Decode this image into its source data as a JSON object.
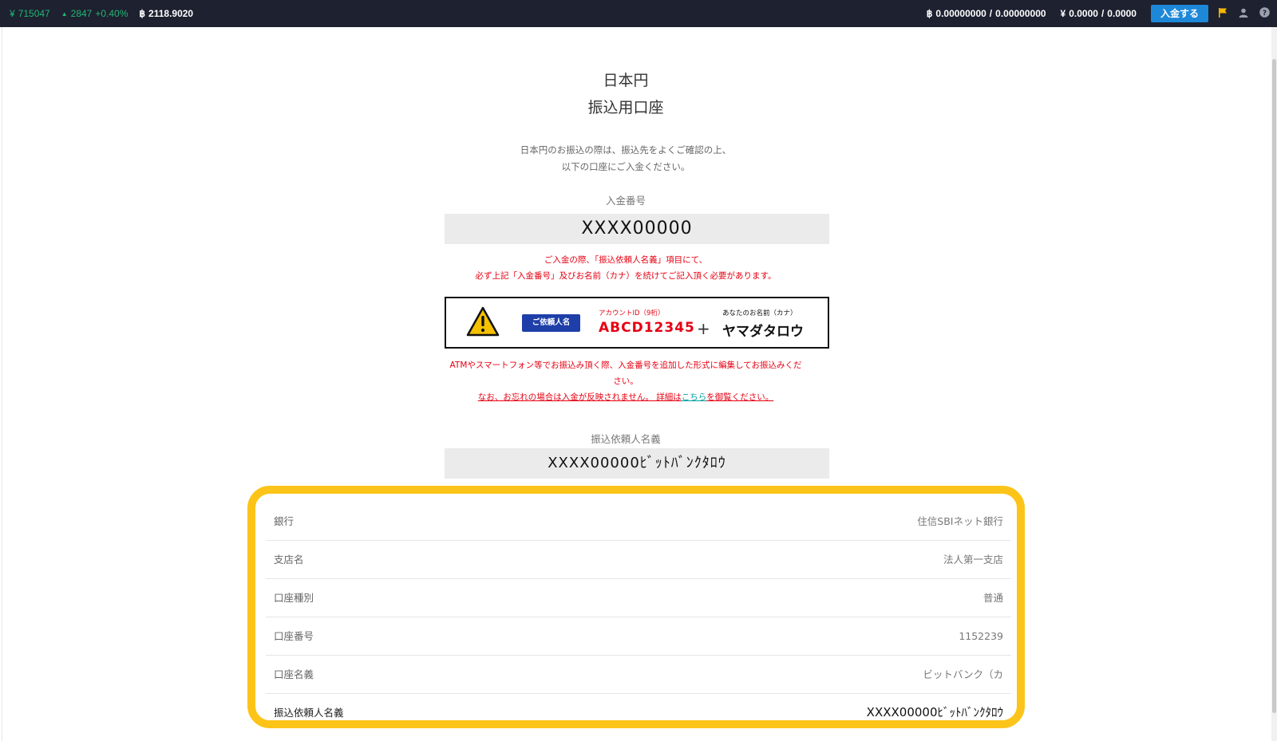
{
  "topbar": {
    "jpy_price": "715047",
    "change_amount": "2847",
    "change_pct": "+0.40%",
    "btc_amount": "2118.9020",
    "btc_balance": "0.00000000",
    "btc_available": "0.00000000",
    "jpy_balance": "0.0000",
    "jpy_available": "0.0000",
    "separator": "/",
    "deposit_button": "入金する",
    "yen_symbol": "¥",
    "btc_symbol": "฿",
    "up_arrow": "▲"
  },
  "header": {
    "title_line1": "日本円",
    "title_line2": "振込用口座"
  },
  "intro": {
    "line1": "日本円のお振込の際は、振込先をよくご確認の上、",
    "line2": "以下の口座にご入金ください。"
  },
  "deposit_number": {
    "label": "入金番号",
    "value": "XXXX00000"
  },
  "red_notice": {
    "line1": "ご入金の際、「振込依頼人名義」項目にて、",
    "line2": "必ず上記「入金番号」及びお名前（カナ）を続けてご記入頂く必要があります。"
  },
  "example_box": {
    "badge": "ご依頼人名",
    "account_label": "アカウントID（9桁）",
    "account_value": "ABCD12345",
    "plus": "+",
    "name_label": "あなたのお名前（カナ）",
    "name_value": "ヤマダタロウ"
  },
  "atm_notice": {
    "line1": "ATMやスマートフォン等でお振込み頂く際、入金番号を追加した形式に編集してお振込みくだ",
    "line2": "さい。",
    "line3_pre": "なお、お忘れの場合は入金が反映されません。 詳細は",
    "line3_link": "こちら",
    "line3_post": "を御覧ください。"
  },
  "requester": {
    "label": "振込依頼人名義",
    "value": "XXXX00000ﾋﾞｯﾄﾊﾞﾝｸﾀﾛｳ"
  },
  "bank_info": [
    {
      "key": "銀行",
      "value": "住信SBIネット銀行"
    },
    {
      "key": "支店名",
      "value": "法人第一支店"
    },
    {
      "key": "口座種別",
      "value": "普通"
    },
    {
      "key": "口座番号",
      "value": "1152239"
    },
    {
      "key": "口座名義",
      "value": "ビットバンク（カ"
    },
    {
      "key": "振込依頼人名義",
      "value": "XXXX00000ﾋﾞｯﾄﾊﾞﾝｸﾀﾛｳ"
    }
  ],
  "colors": {
    "topbar_bg": "#1d2130",
    "accent_green": "#22b573",
    "deposit_button": "#1e88d8",
    "notice_red": "#e60012",
    "highlight_yellow": "#fcc419",
    "badge_blue": "#1e3fa8"
  }
}
